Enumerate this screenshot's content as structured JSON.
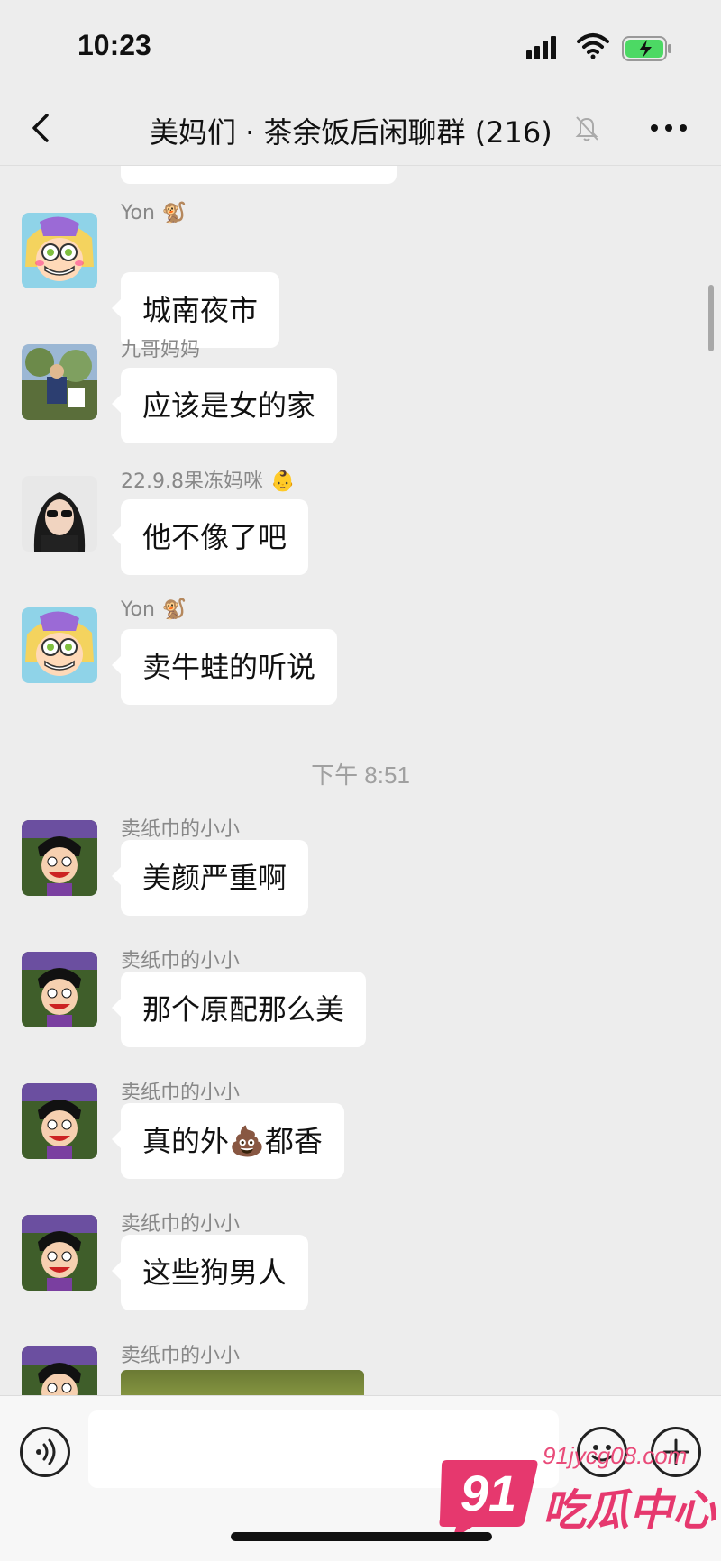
{
  "status": {
    "time": "10:23"
  },
  "nav": {
    "title": "美妈们 · 茶余饭后闲聊群 (216)"
  },
  "chat": {
    "messages": [
      {
        "sender": "Yon",
        "sender_emoji": "🐒",
        "text": "城南夜市",
        "avatar": "cartoon-girl"
      },
      {
        "sender": "九哥妈妈",
        "sender_emoji": "",
        "text": "应该是女的家",
        "avatar": "photo-outdoor"
      },
      {
        "sender": "22.9.8果冻妈咪",
        "sender_emoji": "👶",
        "text": "他不像了吧",
        "avatar": "photo-woman"
      },
      {
        "sender": "Yon",
        "sender_emoji": "🐒",
        "text": "卖牛蛙的听说",
        "avatar": "cartoon-girl"
      },
      {
        "sender": "卖纸巾的小小",
        "sender_emoji": "",
        "text": "美颜严重啊",
        "avatar": "cartoon-boy"
      },
      {
        "sender": "卖纸巾的小小",
        "sender_emoji": "",
        "text": "那个原配那么美",
        "avatar": "cartoon-boy"
      },
      {
        "sender": "卖纸巾的小小",
        "sender_emoji": "",
        "text": "真的外💩都香",
        "avatar": "cartoon-boy"
      },
      {
        "sender": "卖纸巾的小小",
        "sender_emoji": "",
        "text": "这些狗男人",
        "avatar": "cartoon-boy"
      },
      {
        "sender": "卖纸巾的小小",
        "sender_emoji": "",
        "text": "",
        "avatar": "cartoon-boy",
        "type": "image"
      }
    ],
    "time_divider": "下午 8:51"
  },
  "watermark": {
    "url": "91jycg08.com",
    "name": "吃瓜中心",
    "logo_text": "91"
  },
  "colors": {
    "background": "#ededed",
    "bubble": "#ffffff",
    "sender": "#888888",
    "watermark": "#e6386e"
  },
  "icons": [
    "back-icon",
    "mute-icon",
    "more-icon",
    "voice-icon",
    "emoji-icon",
    "plus-icon"
  ]
}
